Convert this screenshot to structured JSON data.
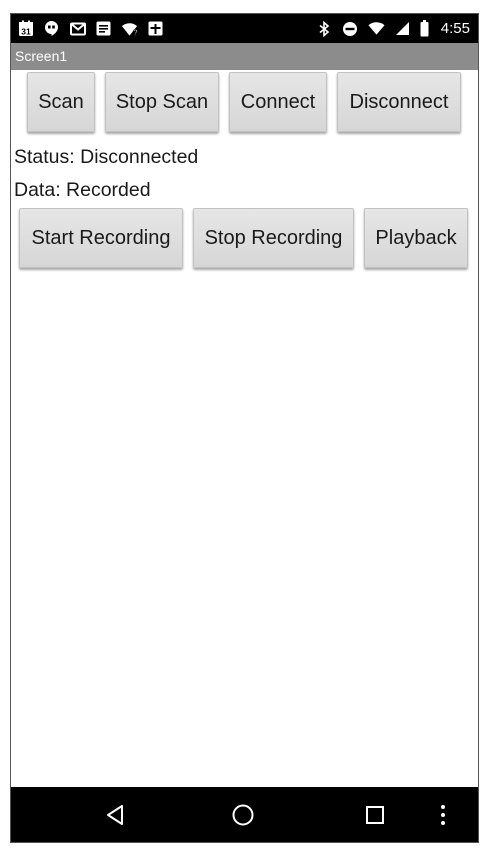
{
  "status_bar": {
    "time": "4:55",
    "calendar_day": "31"
  },
  "title_bar": {
    "title": "Screen1"
  },
  "buttons_row1": {
    "scan": "Scan",
    "stop_scan": "Stop Scan",
    "connect": "Connect",
    "disconnect": "Disconnect"
  },
  "labels": {
    "status": "Status: Disconnected",
    "data": "Data: Recorded"
  },
  "buttons_row2": {
    "start_recording": "Start Recording",
    "stop_recording": "Stop Recording",
    "playback": "Playback"
  },
  "icons": {
    "left": [
      "calendar-icon",
      "hangouts-icon",
      "gmail-icon",
      "notes-icon",
      "wifi-question-icon",
      "plus-box-icon"
    ],
    "right": [
      "bluetooth-icon",
      "do-not-disturb-icon",
      "wifi-icon",
      "signal-icon",
      "battery-icon"
    ],
    "nav": [
      "back-icon",
      "home-icon",
      "recents-icon",
      "overflow-menu-icon"
    ]
  }
}
